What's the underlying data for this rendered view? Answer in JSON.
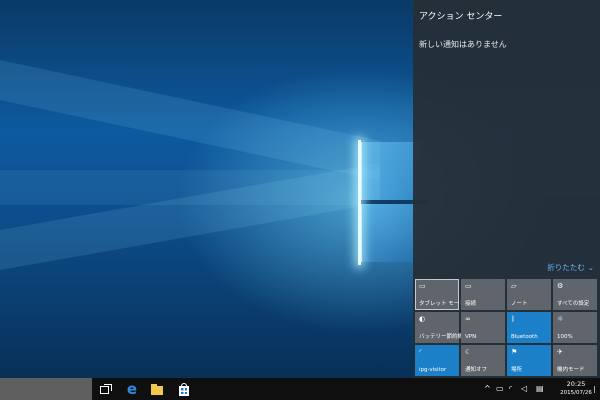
{
  "action_center": {
    "title": "アクション センター",
    "empty_message": "新しい通知はありません",
    "collapse_label": "折りたたむ",
    "tiles": [
      {
        "label": "タブレット モード",
        "icon": "tablet-mode-icon",
        "glyph": "▭",
        "active": false,
        "focused": true
      },
      {
        "label": "接続",
        "icon": "connect-icon",
        "glyph": "▭",
        "active": false
      },
      {
        "label": "ノート",
        "icon": "note-icon",
        "glyph": "▱",
        "active": false
      },
      {
        "label": "すべての設定",
        "icon": "settings-icon",
        "glyph": "⚙",
        "active": false
      },
      {
        "label": "バッテリー節約機能",
        "icon": "battery-saver-icon",
        "glyph": "◐",
        "active": false
      },
      {
        "label": "VPN",
        "icon": "vpn-icon",
        "glyph": "∞",
        "active": false
      },
      {
        "label": "Bluetooth",
        "icon": "bluetooth-icon",
        "glyph": "ᛒ",
        "active": true
      },
      {
        "label": "100%",
        "icon": "brightness-icon",
        "glyph": "☼",
        "active": false
      },
      {
        "label": "ipg-visitor",
        "icon": "wifi-icon",
        "glyph": "◜",
        "active": true
      },
      {
        "label": "通知オフ",
        "icon": "quiet-hours-icon",
        "glyph": "☾",
        "active": false
      },
      {
        "label": "場所",
        "icon": "location-icon",
        "glyph": "⚑",
        "active": true
      },
      {
        "label": "機内モード",
        "icon": "airplane-mode-icon",
        "glyph": "✈",
        "active": false
      }
    ]
  },
  "taskbar": {
    "tray_chevron_glyph": "^",
    "battery_glyph": "▭",
    "network_glyph": "◜",
    "volume_glyph": "◁",
    "notification_glyph": "▤",
    "clock_time": "20:25",
    "clock_date": "2015/07/26"
  },
  "colors": {
    "accent": "#1c80c8",
    "tile_inactive": "#5f656b",
    "link": "#6ab8f0"
  }
}
